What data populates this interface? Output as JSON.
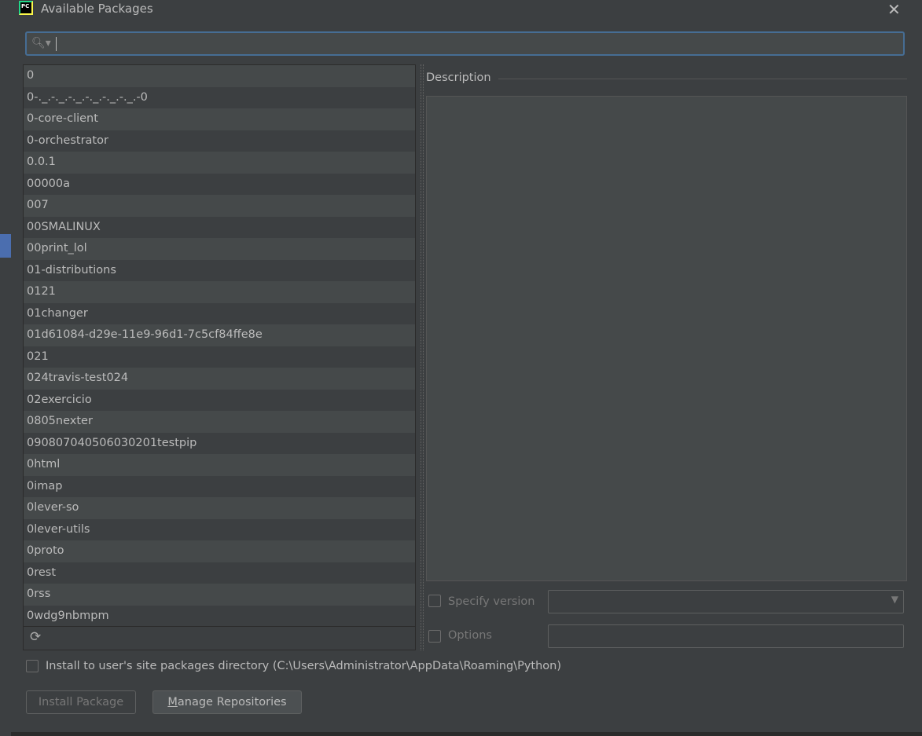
{
  "dialog": {
    "title": "Available Packages",
    "close": "✕"
  },
  "search": {
    "value": "",
    "icon": "search-icon"
  },
  "packages": [
    "0",
    "0-._.-._.-._.-._.-._.-._.-0",
    "0-core-client",
    "0-orchestrator",
    "0.0.1",
    "00000a",
    "007",
    "00SMALINUX",
    "00print_lol",
    "01-distributions",
    "0121",
    "01changer",
    "01d61084-d29e-11e9-96d1-7c5cf84ffe8e",
    "021",
    "024travis-test024",
    "02exercicio",
    "0805nexter",
    "090807040506030201testpip",
    "0html",
    "0imap",
    "0lever-so",
    "0lever-utils",
    "0proto",
    "0rest",
    "0rss",
    "0wdg9nbmpm"
  ],
  "description": {
    "label": "Description"
  },
  "specify_version": {
    "label": "Specify version",
    "checked": false,
    "value": ""
  },
  "options": {
    "label": "Options",
    "checked": false,
    "value": ""
  },
  "install_user": {
    "label": "Install to user's site packages directory (C:\\Users\\Administrator\\AppData\\Roaming\\Python)",
    "checked": false
  },
  "buttons": {
    "install": "Install Package",
    "manage_m": "M",
    "manage_rest": "anage Repositories"
  }
}
